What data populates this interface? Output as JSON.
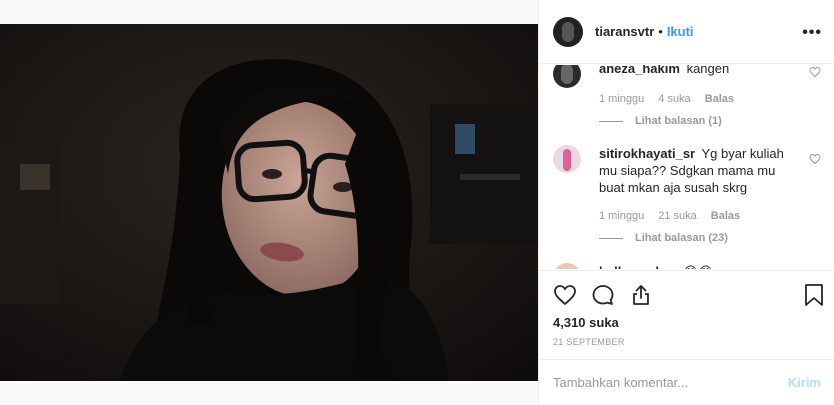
{
  "post": {
    "author": "tiaransvtr",
    "separator": "•",
    "follow_label": "Ikuti",
    "more_icon": "more-options-icon"
  },
  "comments": [
    {
      "username": "aneza_hakim",
      "text": "kangen",
      "time": "1 minggu",
      "likes": "4 suka",
      "reply_label": "Balas",
      "view_replies": "Lihat balasan (1)"
    },
    {
      "username": "sitirokhayati_sr",
      "text": "Yg byar kuliah mu siapa?? Sdgkan mama mu buat mkan aja susah skrg",
      "time": "1 minggu",
      "likes": "21 suka",
      "reply_label": "Balas",
      "view_replies": "Lihat balasan (23)"
    },
    {
      "username": "kollarsyahru",
      "text": "😂😂"
    }
  ],
  "actions": {
    "like_icon": "heart-icon",
    "comment_icon": "comment-icon",
    "share_icon": "share-icon",
    "save_icon": "bookmark-icon"
  },
  "likes_count": "4,310 suka",
  "date": "21 SEPTEMBER",
  "composer": {
    "placeholder": "Tambahkan komentar...",
    "send_label": "Kirim"
  },
  "colors": {
    "accent": "#3897f0",
    "send_disabled": "#b2dffc",
    "muted": "#999999"
  }
}
